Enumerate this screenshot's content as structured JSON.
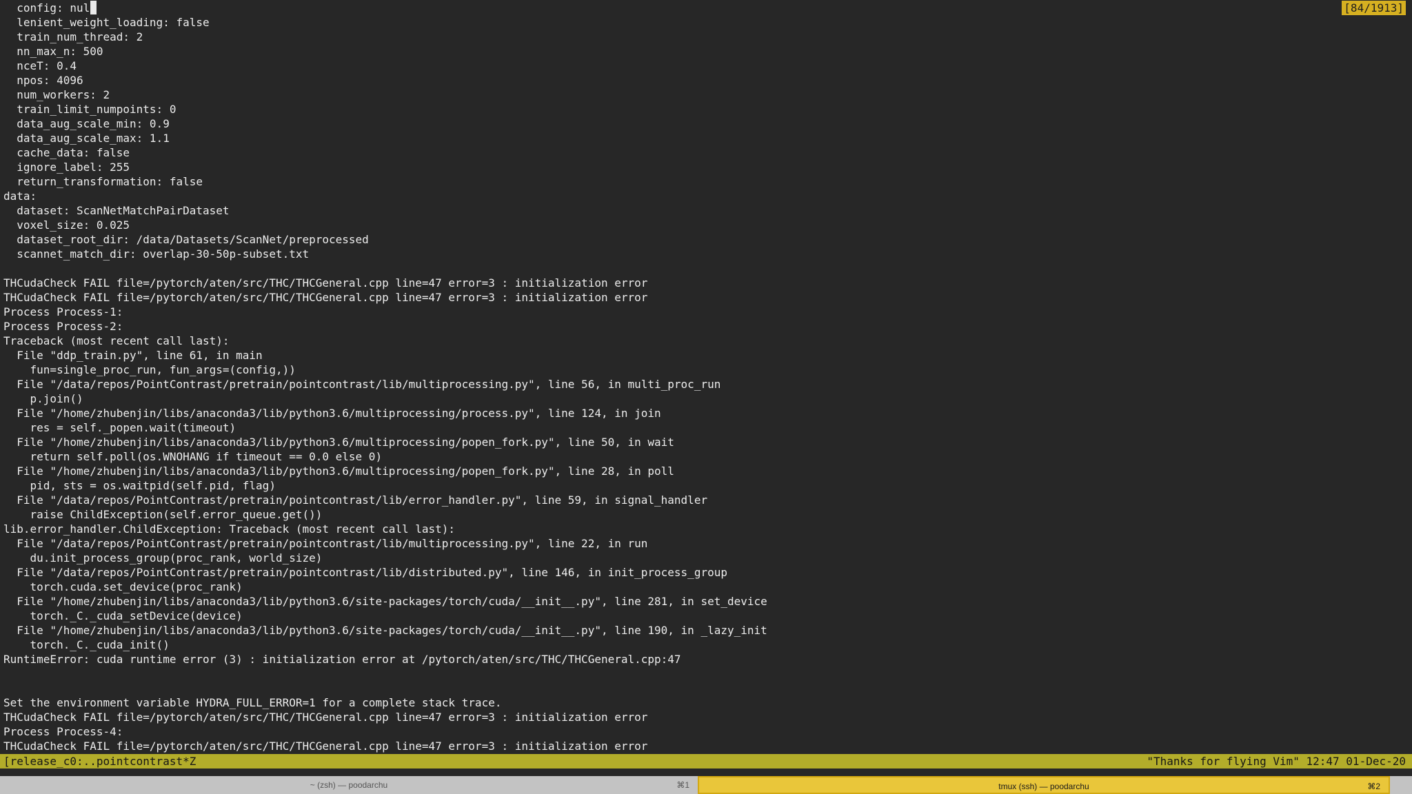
{
  "terminal": {
    "lines": [
      "  config: null",
      "  lenient_weight_loading: false",
      "  train_num_thread: 2",
      "  nn_max_n: 500",
      "  nceT: 0.4",
      "  npos: 4096",
      "  num_workers: 2",
      "  train_limit_numpoints: 0",
      "  data_aug_scale_min: 0.9",
      "  data_aug_scale_max: 1.1",
      "  cache_data: false",
      "  ignore_label: 255",
      "  return_transformation: false",
      "data:",
      "  dataset: ScanNetMatchPairDataset",
      "  voxel_size: 0.025",
      "  dataset_root_dir: /data/Datasets/ScanNet/preprocessed",
      "  scannet_match_dir: overlap-30-50p-subset.txt",
      "",
      "THCudaCheck FAIL file=/pytorch/aten/src/THC/THCGeneral.cpp line=47 error=3 : initialization error",
      "THCudaCheck FAIL file=/pytorch/aten/src/THC/THCGeneral.cpp line=47 error=3 : initialization error",
      "Process Process-1:",
      "Process Process-2:",
      "Traceback (most recent call last):",
      "  File \"ddp_train.py\", line 61, in main",
      "    fun=single_proc_run, fun_args=(config,))",
      "  File \"/data/repos/PointContrast/pretrain/pointcontrast/lib/multiprocessing.py\", line 56, in multi_proc_run",
      "    p.join()",
      "  File \"/home/zhubenjin/libs/anaconda3/lib/python3.6/multiprocessing/process.py\", line 124, in join",
      "    res = self._popen.wait(timeout)",
      "  File \"/home/zhubenjin/libs/anaconda3/lib/python3.6/multiprocessing/popen_fork.py\", line 50, in wait",
      "    return self.poll(os.WNOHANG if timeout == 0.0 else 0)",
      "  File \"/home/zhubenjin/libs/anaconda3/lib/python3.6/multiprocessing/popen_fork.py\", line 28, in poll",
      "    pid, sts = os.waitpid(self.pid, flag)",
      "  File \"/data/repos/PointContrast/pretrain/pointcontrast/lib/error_handler.py\", line 59, in signal_handler",
      "    raise ChildException(self.error_queue.get())",
      "lib.error_handler.ChildException: Traceback (most recent call last):",
      "  File \"/data/repos/PointContrast/pretrain/pointcontrast/lib/multiprocessing.py\", line 22, in run",
      "    du.init_process_group(proc_rank, world_size)",
      "  File \"/data/repos/PointContrast/pretrain/pointcontrast/lib/distributed.py\", line 146, in init_process_group",
      "    torch.cuda.set_device(proc_rank)",
      "  File \"/home/zhubenjin/libs/anaconda3/lib/python3.6/site-packages/torch/cuda/__init__.py\", line 281, in set_device",
      "    torch._C._cuda_setDevice(device)",
      "  File \"/home/zhubenjin/libs/anaconda3/lib/python3.6/site-packages/torch/cuda/__init__.py\", line 190, in _lazy_init",
      "    torch._C._cuda_init()",
      "RuntimeError: cuda runtime error (3) : initialization error at /pytorch/aten/src/THC/THCGeneral.cpp:47",
      "",
      "",
      "Set the environment variable HYDRA_FULL_ERROR=1 for a complete stack trace.",
      "THCudaCheck FAIL file=/pytorch/aten/src/THC/THCGeneral.cpp line=47 error=3 : initialization error",
      "Process Process-4:",
      "THCudaCheck FAIL file=/pytorch/aten/src/THC/THCGeneral.cpp line=47 error=3 : initialization error"
    ],
    "position_indicator": "[84/1913]"
  },
  "tmux_status": {
    "left": "[release_c0:..pointcontrast*Z",
    "right": "\"Thanks for flying Vim\" 12:47 01-Dec-20"
  },
  "tabs": [
    {
      "title": "~ (zsh) — poodarchu",
      "shortcut": "⌘1",
      "active": false
    },
    {
      "title": "tmux (ssh) — poodarchu",
      "shortcut": "⌘2",
      "active": true
    }
  ],
  "colors": {
    "terminal_bg": "#272727",
    "terminal_fg": "#ececec",
    "status_bar": "#b3ad2a",
    "active_tab": "#e9c63a",
    "inactive_tab": "#c3c3c3"
  }
}
